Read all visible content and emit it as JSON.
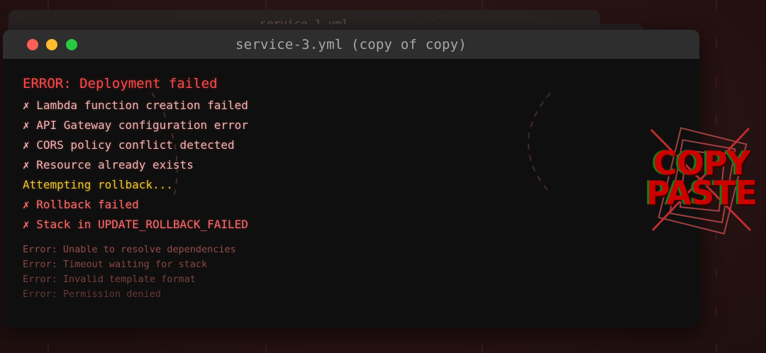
{
  "background_window": {
    "title": "service-1.yml"
  },
  "window": {
    "title": "service-3.yml (copy of copy)",
    "controls": {
      "close_color": "#ff5f57",
      "minimize_color": "#febc2e",
      "maximize_color": "#28c840"
    }
  },
  "output": {
    "header": "ERROR: Deployment failed",
    "failures": [
      "✗ Lambda function creation failed",
      "✗ API Gateway configuration error",
      "✗ CORS policy conflict detected",
      "✗ Resource already exists"
    ],
    "rollback_status": "Attempting rollback...",
    "rollback_failures": [
      "✗ Rollback failed",
      "✗ Stack in UPDATE_ROLLBACK_FAILED"
    ],
    "logs": [
      "Error: Unable to resolve dependencies",
      "Error: Timeout waiting for stack",
      "Error: Invalid template format",
      "Error: Permission denied"
    ]
  },
  "stamp": {
    "line1": "COPY",
    "line2": "PASTE"
  },
  "colors": {
    "error_header": "#ff4a4a",
    "error_line": "#f5b3b3",
    "warning": "#f2c12e",
    "failure": "#ff6b6b",
    "log": "#a05050",
    "stamp_red": "#cc0000"
  }
}
